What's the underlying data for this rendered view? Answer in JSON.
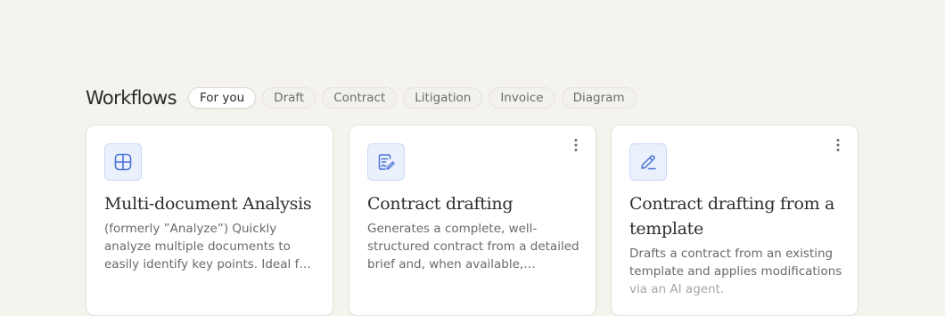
{
  "header": {
    "title": "Workflows"
  },
  "filters": [
    {
      "label": "For you",
      "active": true
    },
    {
      "label": "Draft",
      "active": false
    },
    {
      "label": "Contract",
      "active": false
    },
    {
      "label": "Litigation",
      "active": false
    },
    {
      "label": "Invoice",
      "active": false
    },
    {
      "label": "Diagram",
      "active": false
    }
  ],
  "cards": [
    {
      "icon": "table-grid-icon",
      "title": "Multi-document Analysis",
      "description": "(formerly ”Analyze”) Quickly analyze multiple documents to easily identify key points. Ideal for audits…",
      "has_menu": false
    },
    {
      "icon": "document-signature-icon",
      "title": "Contract drafting",
      "description": "Generates a complete, well-structured contract from a detailed brief and, when available, supportin…",
      "has_menu": true
    },
    {
      "icon": "pencil-edit-icon",
      "title": "Contract drafting from a template",
      "description_lines": [
        "Drafts a contract from an existing",
        "template and applies modifications",
        "via an AI agent."
      ],
      "has_menu": true
    }
  ],
  "colors": {
    "background": "#f5f3ee",
    "icon_accent": "#4a72d8",
    "icon_bg": "#eaf0fc"
  }
}
